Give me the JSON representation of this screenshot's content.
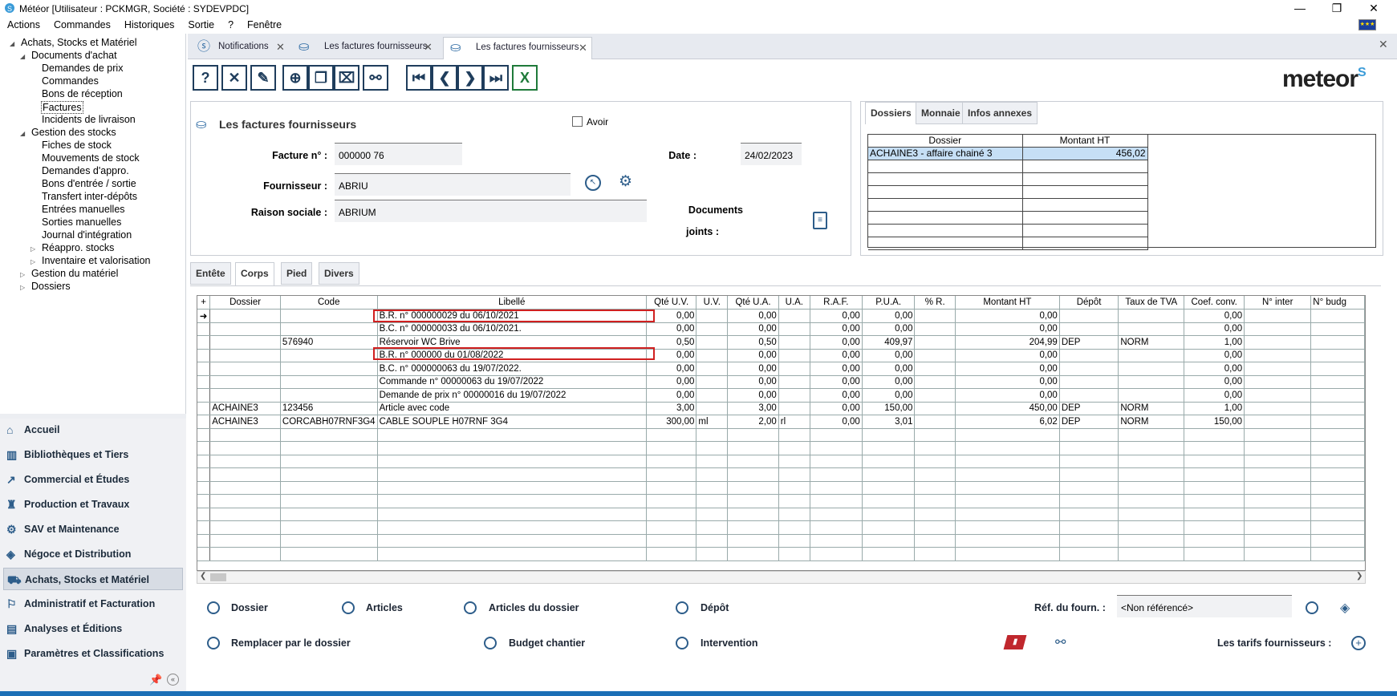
{
  "window": {
    "title": "Météor [Utilisateur : PCKMGR, Société : SYDEVPDC]",
    "minimize": "—",
    "maximize": "❐",
    "close": "✕"
  },
  "menu": [
    "Actions",
    "Commandes",
    "Historiques",
    "Sortie",
    "?",
    "Fenêtre"
  ],
  "tree": {
    "root": "Achats, Stocks et Matériel",
    "docs": "Documents d'achat",
    "docs_items": [
      "Demandes de prix",
      "Commandes",
      "Bons de réception",
      "Factures",
      "Incidents de livraison"
    ],
    "stock": "Gestion des stocks",
    "stock_items": [
      "Fiches de stock",
      "Mouvements de stock",
      "Demandes d'appro.",
      "Bons d'entrée / sortie",
      "Transfert inter-dépôts",
      "Entrées manuelles",
      "Sorties manuelles",
      "Journal d'intégration"
    ],
    "stock_sub": [
      "Réappro. stocks",
      "Inventaire et valorisation"
    ],
    "others": [
      "Gestion du matériel",
      "Dossiers"
    ]
  },
  "modules": [
    "Accueil",
    "Bibliothèques et Tiers",
    "Commercial et Études",
    "Production et Travaux",
    "SAV et Maintenance",
    "Négoce et Distribution",
    "Achats, Stocks et Matériel",
    "Administratif et Facturation",
    "Analyses et Éditions",
    "Paramètres et Classifications"
  ],
  "tabs": [
    "Notifications",
    "Les factures fournisseurs",
    "Les factures fournisseurs"
  ],
  "logo": {
    "text": "meteor",
    "mark": "S"
  },
  "form": {
    "title": "Les factures fournisseurs",
    "avoir": "Avoir",
    "facture_label": "Facture n° :",
    "facture_value": "000000 76",
    "date_label": "Date :",
    "date_value": "24/02/2023",
    "fournisseur_label": "Fournisseur :",
    "fournisseur_value": "ABRIU",
    "raison_label": "Raison sociale :",
    "raison_value": "ABRIUM",
    "docs_label1": "Documents",
    "docs_label2": "joints :"
  },
  "righttabs": [
    "Dossiers",
    "Monnaie",
    "Infos annexes"
  ],
  "dossiers_table": {
    "headers": [
      "Dossier",
      "Montant HT"
    ],
    "rows": [
      [
        "ACHAINE3 - affaire chainé 3",
        "456,02"
      ]
    ]
  },
  "subtabs": [
    "Entête",
    "Corps",
    "Pied",
    "Divers"
  ],
  "grid": {
    "headers": [
      "+",
      "Dossier",
      "Code",
      "Libellé",
      "Qté U.V.",
      "U.V.",
      "Qté U.A.",
      "U.A.",
      "R.A.F.",
      "P.U.A.",
      "% R.",
      "Montant HT",
      "Dépôt",
      "Taux de TVA",
      "Coef. conv.",
      "N° inter",
      "N° budg"
    ],
    "rows": [
      [
        "➜",
        "",
        "",
        "B.R. n° 000000029  du 06/10/2021",
        "0,00",
        "",
        "0,00",
        "",
        "0,00",
        "0,00",
        "",
        "0,00",
        "",
        "",
        "0,00",
        "",
        ""
      ],
      [
        "",
        "",
        "",
        "B.C. n° 000000033  du 06/10/2021.",
        "0,00",
        "",
        "0,00",
        "",
        "0,00",
        "0,00",
        "",
        "0,00",
        "",
        "",
        "0,00",
        "",
        ""
      ],
      [
        "",
        "",
        "576940",
        "Réservoir WC Brive",
        "0,50",
        "",
        "0,50",
        "",
        "0,00",
        "409,97",
        "",
        "204,99",
        "DEP",
        "NORM",
        "1,00",
        "",
        ""
      ],
      [
        "",
        "",
        "",
        "B.R. n° 000000     du 01/08/2022",
        "0,00",
        "",
        "0,00",
        "",
        "0,00",
        "0,00",
        "",
        "0,00",
        "",
        "",
        "0,00",
        "",
        ""
      ],
      [
        "",
        "",
        "",
        "B.C. n° 000000063 du 19/07/2022.",
        "0,00",
        "",
        "0,00",
        "",
        "0,00",
        "0,00",
        "",
        "0,00",
        "",
        "",
        "0,00",
        "",
        ""
      ],
      [
        "",
        "",
        "",
        "Commande n° 00000063 du 19/07/2022",
        "0,00",
        "",
        "0,00",
        "",
        "0,00",
        "0,00",
        "",
        "0,00",
        "",
        "",
        "0,00",
        "",
        ""
      ],
      [
        "",
        "",
        "",
        "Demande de prix n° 00000016 du 19/07/2022",
        "0,00",
        "",
        "0,00",
        "",
        "0,00",
        "0,00",
        "",
        "0,00",
        "",
        "",
        "0,00",
        "",
        ""
      ],
      [
        "",
        "ACHAINE3",
        "123456",
        "Article avec code",
        "3,00",
        "",
        "3,00",
        "",
        "0,00",
        "150,00",
        "",
        "450,00",
        "DEP",
        "NORM",
        "1,00",
        "",
        ""
      ],
      [
        "",
        "ACHAINE3",
        "CORCABH07RNF3G4",
        "CABLE SOUPLE H07RNF 3G4",
        "300,00",
        "ml",
        "2,00",
        "rl",
        "0,00",
        "3,01",
        "",
        "6,02",
        "DEP",
        "NORM",
        "150,00",
        "",
        ""
      ]
    ]
  },
  "bottom": {
    "links1": [
      "Dossier",
      "Articles",
      "Articles du dossier",
      "Dépôt"
    ],
    "links2": [
      "Remplacer par le dossier",
      "Budget chantier",
      "Intervention"
    ],
    "ref_label": "Réf. du fourn. :",
    "ref_value": "<Non référencé>",
    "tarifs": "Les tarifs fournisseurs :"
  }
}
